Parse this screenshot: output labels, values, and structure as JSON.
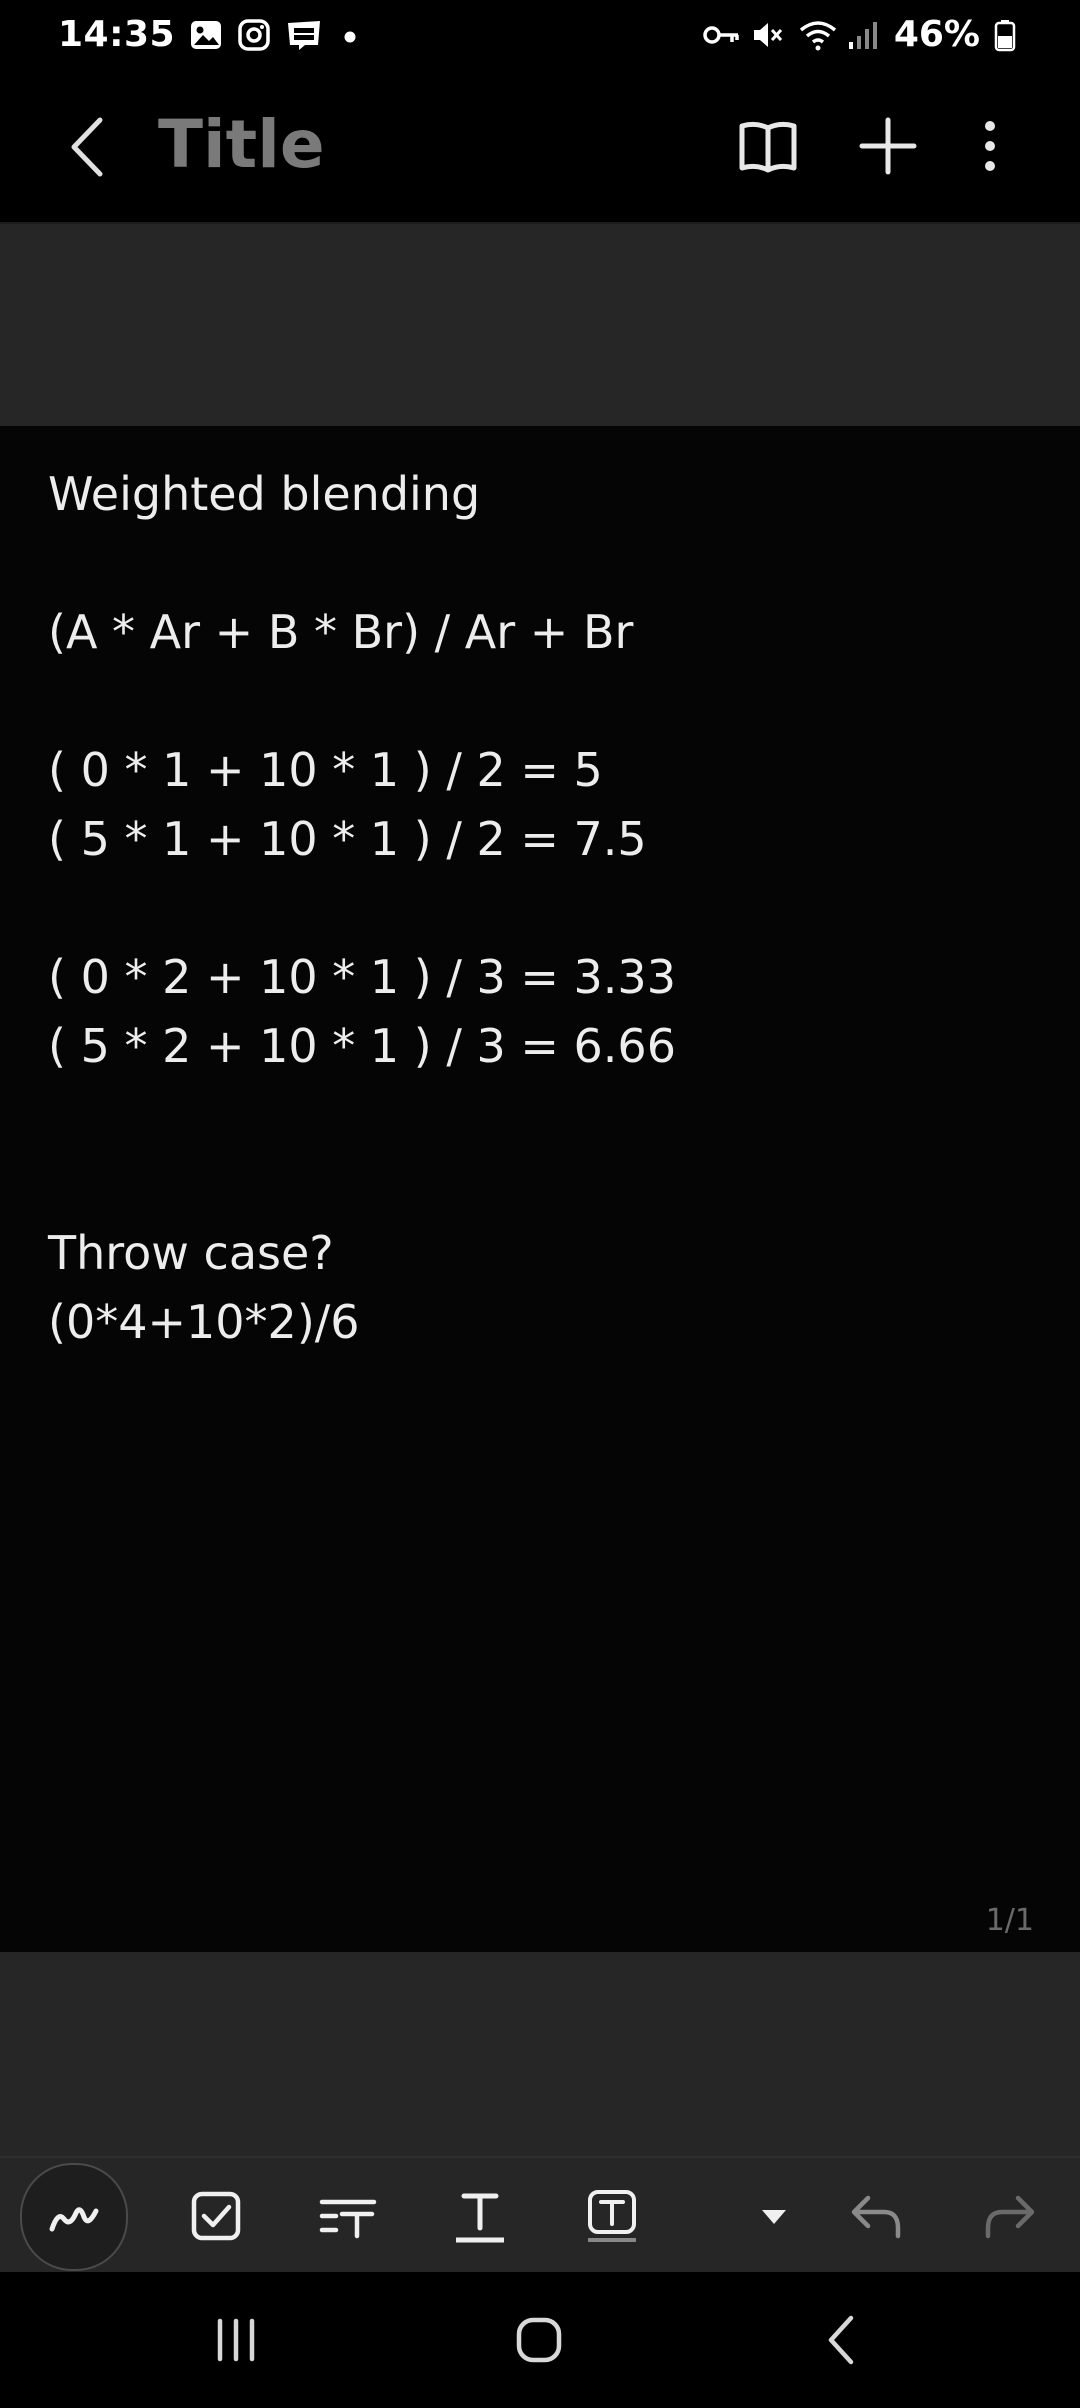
{
  "status_bar": {
    "time": "14:35",
    "battery": "46%",
    "left_icons": [
      "gallery-icon",
      "instagram-icon",
      "webtoon-icon",
      "dot-icon"
    ],
    "right_icons": [
      "vpn-key-icon",
      "mute-icon",
      "wifi-icon",
      "signal-icon",
      "battery-icon"
    ]
  },
  "app_bar": {
    "title": "Title",
    "actions": [
      "reading-mode-icon",
      "add-icon",
      "more-options-icon"
    ]
  },
  "note": {
    "lines": [
      "Weighted blending",
      "",
      "(A * Ar + B * Br) / Ar + Br",
      "",
      "( 0 * 1 + 10 * 1 ) / 2 = 5",
      "( 5 * 1 + 10 * 1 ) / 2 = 7.5",
      "",
      "( 0 * 2 + 10 * 1 ) / 3 = 3.33",
      "( 5 * 2 + 10 * 1 ) / 3 = 6.66",
      "",
      "",
      "Throw case?",
      "(0*4+10*2)/6"
    ],
    "page_indicator": "1/1"
  },
  "toolbar": {
    "tools": [
      "pen-icon",
      "checkbox-icon",
      "text-style-icon",
      "text-icon",
      "text-box-icon",
      "dropdown-arrow-icon",
      "undo-icon",
      "redo-icon"
    ]
  },
  "nav_bar": {
    "buttons": [
      "recents-icon",
      "home-icon",
      "back-icon"
    ]
  },
  "colors": {
    "background": "#050505",
    "panel": "#262626",
    "text": "#ededed",
    "title_muted": "#7a7a7a"
  }
}
